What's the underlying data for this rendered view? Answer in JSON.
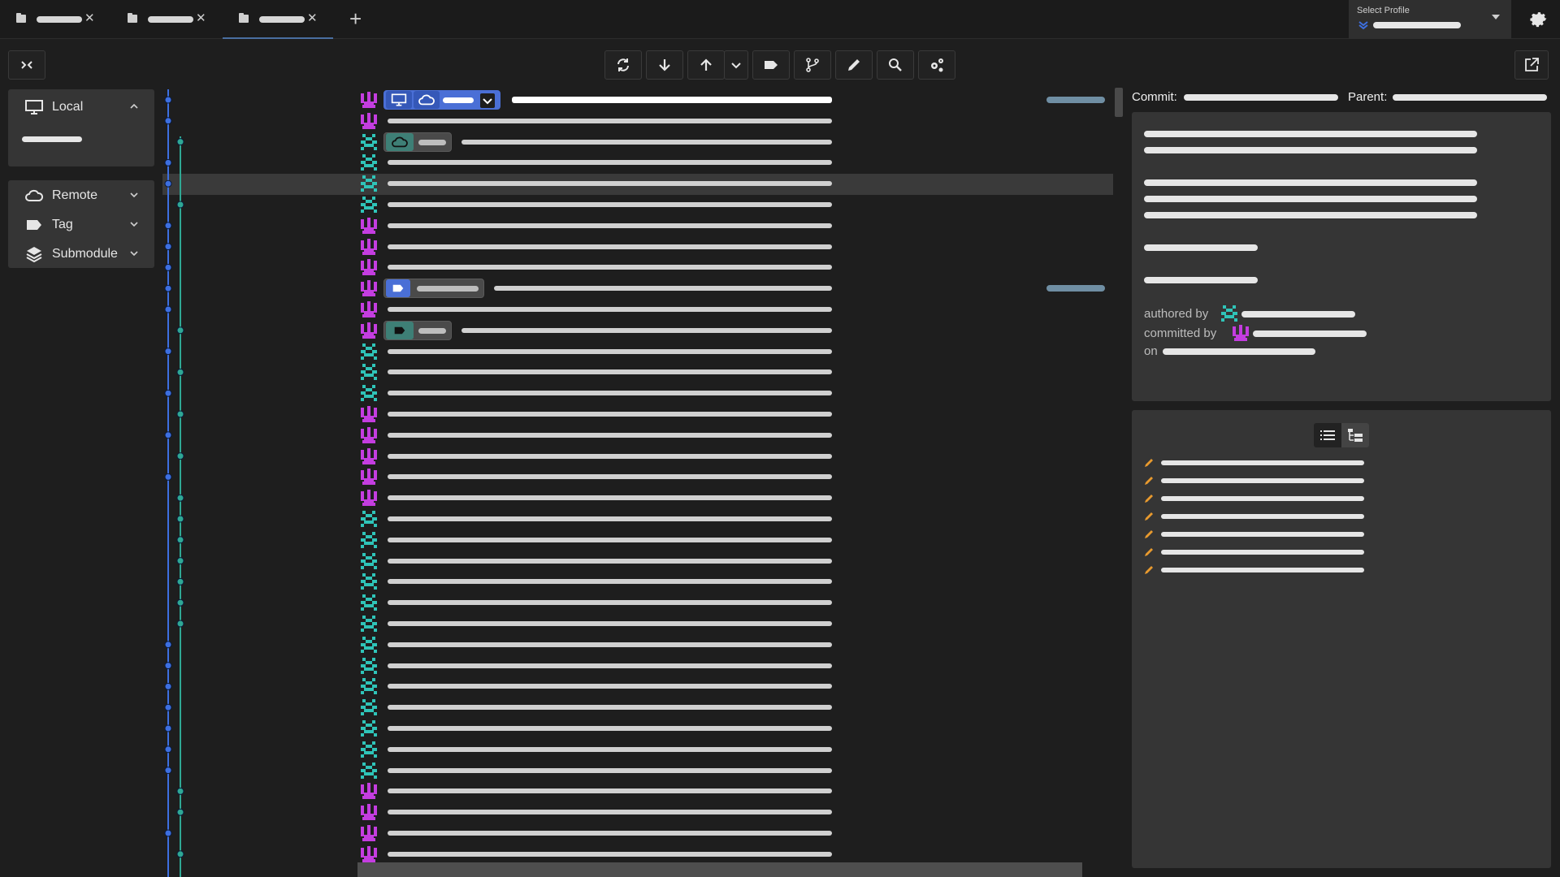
{
  "colors": {
    "accent_blue": "#4a6fd6",
    "author_magenta": "#c43de0",
    "author_teal": "#2fc4b8",
    "graph_blue": "#3d6fe0",
    "graph_teal": "#2fa894",
    "edit_orange": "#e89a2e"
  },
  "tabs": [
    {
      "icon": "folder-icon",
      "close": "✕"
    },
    {
      "icon": "folder-icon",
      "close": "✕"
    },
    {
      "icon": "folder-icon",
      "close": "✕",
      "active": true
    }
  ],
  "new_tab_label": "+",
  "profile": {
    "label": "Select Profile"
  },
  "toolbar": {
    "buttons": [
      "refresh-icon",
      "pull-icon",
      "push-icon",
      "push-options-icon",
      "tag-icon",
      "branch-icon",
      "edit-icon",
      "search-icon",
      "settings-icon"
    ]
  },
  "sidebar": {
    "local": {
      "label": "Local"
    },
    "remote": {
      "label": "Remote"
    },
    "tag": {
      "label": "Tag"
    },
    "submodule": {
      "label": "Submodule"
    }
  },
  "details": {
    "commit_label": "Commit:",
    "parent_label": "Parent:",
    "authored_by": "authored by",
    "committed_by": "committed by",
    "on": "on"
  },
  "commits": [
    {
      "author": "magenta",
      "graph": "blue"
    },
    {
      "author": "magenta",
      "graph": "blue"
    },
    {
      "author": "teal",
      "graph": "teal"
    },
    {
      "author": "teal",
      "graph": "blue"
    },
    {
      "author": "teal",
      "graph": "blue"
    },
    {
      "author": "teal",
      "graph": "teal"
    },
    {
      "author": "magenta",
      "graph": "blue"
    },
    {
      "author": "magenta",
      "graph": "blue"
    },
    {
      "author": "magenta",
      "graph": "blue"
    },
    {
      "author": "magenta",
      "graph": "blue"
    },
    {
      "author": "magenta",
      "graph": "blue"
    },
    {
      "author": "magenta",
      "graph": "teal"
    },
    {
      "author": "teal",
      "graph": "blue"
    },
    {
      "author": "teal",
      "graph": "teal"
    },
    {
      "author": "teal",
      "graph": "blue"
    },
    {
      "author": "magenta",
      "graph": "teal"
    },
    {
      "author": "magenta",
      "graph": "blue"
    },
    {
      "author": "magenta",
      "graph": "teal"
    },
    {
      "author": "magenta",
      "graph": "blue"
    },
    {
      "author": "magenta",
      "graph": "teal"
    },
    {
      "author": "teal",
      "graph": "teal"
    },
    {
      "author": "teal",
      "graph": "teal"
    },
    {
      "author": "teal",
      "graph": "teal"
    },
    {
      "author": "teal",
      "graph": "teal"
    },
    {
      "author": "teal",
      "graph": "teal"
    },
    {
      "author": "teal",
      "graph": "teal"
    },
    {
      "author": "teal",
      "graph": "blue"
    },
    {
      "author": "teal",
      "graph": "blue"
    },
    {
      "author": "teal",
      "graph": "blue"
    },
    {
      "author": "teal",
      "graph": "blue"
    },
    {
      "author": "teal",
      "graph": "blue"
    },
    {
      "author": "teal",
      "graph": "blue"
    },
    {
      "author": "teal",
      "graph": "blue"
    },
    {
      "author": "magenta",
      "graph": "teal"
    },
    {
      "author": "magenta",
      "graph": "teal"
    },
    {
      "author": "magenta",
      "graph": "blue"
    },
    {
      "author": "magenta",
      "graph": "teal"
    }
  ],
  "changed_files_count": 7
}
